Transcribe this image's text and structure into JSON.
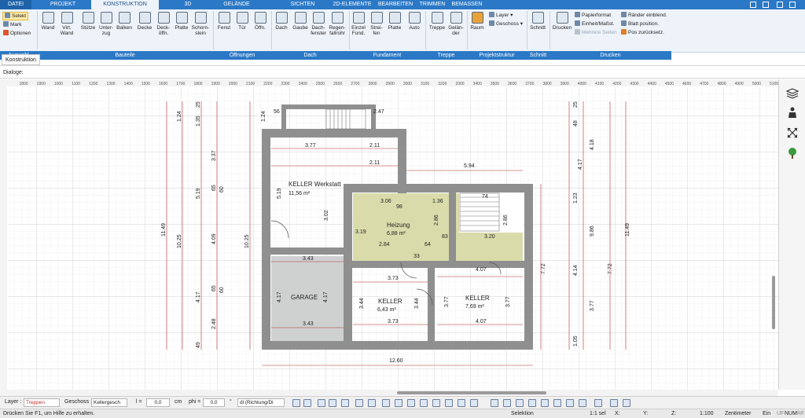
{
  "tabs": {
    "file": "DATEI",
    "projekt": "PROJEKT",
    "konstruktion": "KONSTRUKTION",
    "d3": "3D",
    "gelaende": "GELÄNDE",
    "sichten": "SICHTEN",
    "elemente2d": "2D-ELEMENTE",
    "bearbeiten": "BEARBEITEN",
    "trimmen": "TRIMMEN",
    "bemassen": "BEMASSEN"
  },
  "ribbon": {
    "selekt": "Selekt",
    "mark": "Mark",
    "optionen": "Optionen",
    "wand": "Wand",
    "virt_wand": "Virt. Wand",
    "stuetze": "Stütze",
    "unterzug": "Unter-zug",
    "balken": "Balken",
    "decke": "Decke",
    "deckoeffn": "Deck-öffn.",
    "platte": "Platte",
    "schornstein": "Schorn-stein",
    "fenst": "Fenst",
    "tuer": "Tür",
    "oeffn": "Öffn.",
    "dach": "Dach",
    "gaube": "Gaube",
    "dachfenster": "Dach-fenster",
    "regenfallrohr": "Regen-fallrohr",
    "einzelfund": "Einzel Fund.",
    "streifen": "Strei-fen",
    "platte2": "Platte",
    "auto": "Auto",
    "treppe": "Treppe",
    "gelaender": "Gelän-der",
    "raum": "Raum",
    "layer": "Layer",
    "geschoss": "Geschoss",
    "schnitt": "Schnitt",
    "drucken": "Drucken",
    "papierformat": "Papierformat",
    "einheit": "Einheit/Maßst.",
    "mehrere_seiten": "Mehrere Seiten",
    "raender": "Ränder einblend.",
    "blatt": "Blatt position.",
    "pos_zurueck": "Pos zurücksetz."
  },
  "groups": {
    "auswahl": "Auswahl",
    "bauteile": "Bauteile",
    "oeffnungen": "Öffnungen",
    "dach": "Dach",
    "fundament": "Fundament",
    "treppe": "Treppe",
    "projektstruktur": "Projektstruktur",
    "schnitt": "Schnitt",
    "drucken": "Drucken"
  },
  "subtab": "Konstruktion",
  "dialoge": "Dialoge:",
  "ruler": [
    "1800",
    "1900",
    "1000",
    "1100",
    "1200",
    "1300",
    "1400",
    "1500",
    "1600",
    "1700",
    "1800",
    "1900",
    "2000",
    "2100",
    "2200",
    "2300",
    "2400",
    "2500",
    "2600",
    "2700",
    "2800",
    "2900",
    "3000",
    "3100",
    "3200",
    "3300",
    "3400",
    "3500",
    "3600",
    "3700",
    "3800",
    "3900",
    "4000",
    "4100",
    "4200",
    "4300",
    "4400",
    "4500",
    "4600",
    "4700",
    "4800",
    "4900",
    "5000",
    "5100",
    "5200"
  ],
  "plan": {
    "rooms": {
      "werkstatt_name": "KELLER Werkstatt",
      "werkstatt_area": "11,56 m²",
      "heizung_name": "Heizung",
      "heizung_area": "6,88 m²",
      "garage_name": "GARAGE",
      "keller1_name": "KELLER",
      "keller1_area": "6,43 m²",
      "keller2_name": "KELLER",
      "keller2_area": "7,69 m²"
    },
    "dims": {
      "d377": "3.77",
      "d211a": "2.11",
      "d211b": "2.11",
      "d594": "5.94",
      "d306": "3.06",
      "d136": "1.36",
      "d74": "74",
      "d284": "2.84",
      "d64": "64",
      "d83": "83",
      "d320": "3.20",
      "d343a": "3.43",
      "d343b": "3.43",
      "d373a": "3.73",
      "d373b": "3.73",
      "d407a": "4.07",
      "d407b": "4.07",
      "d1260": "12.60",
      "d56": "56",
      "d247": "2.47",
      "d519": "5.19",
      "d302": "3.02",
      "d319": "3.19",
      "d286a": "2.86",
      "d286b": "2.86",
      "d417a": "4.17",
      "d417b": "4.17",
      "d344a": "3.44",
      "d344b": "3.44",
      "d377b": "3.77",
      "d377c": "3.77",
      "d98": "98",
      "d33": "33",
      "d1149": "11.49",
      "d1025a": "10.25",
      "d1025b": "10.25",
      "d519b": "5.19",
      "d409": "4.09",
      "d337": "3.37",
      "d248": "2.48",
      "d417c": "4.17",
      "d65a": "65",
      "d65b": "65",
      "d124a": "1.24",
      "d124b": "1.24",
      "d135": "1.35",
      "d25": "25",
      "d60a": "60",
      "d60b": "60",
      "d49": "49",
      "d772a": "7.72",
      "d772b": "7.72",
      "d417d": "4.17",
      "d418": "4.18",
      "d1149b": "11.49",
      "d986": "9.86",
      "d414": "4.14",
      "d377d": "3.77",
      "d123": "1.23",
      "d105": "1.05",
      "d48": "48",
      "d25b": "25"
    }
  },
  "statusbar": {
    "layer_label": "Layer :",
    "layer_value": "Treppen",
    "geschoss_label": "Geschoss :",
    "geschoss_value": "Kellergesch",
    "l_label": "l =",
    "l_value": "0,0",
    "cm": "cm",
    "phi_label": "phi =",
    "phi_value": "0,0",
    "deg": "°",
    "mode": "dl (Richtung/Di",
    "help": "Drücken Sie F1, um Hilfe zu erhalten.",
    "selektion": "Selektion",
    "scale1": "1:1 sel",
    "x": "X:",
    "y": "Y:",
    "z": "Z:",
    "scale2": "1:100",
    "unit": "Zentimeter",
    "ein": "Ein",
    "uf": "UF",
    "num": "NUM",
    "rf": "RF"
  },
  "colors": {
    "ribbon_blue": "#2b78c6",
    "heizung_fill": "#d9dcaa",
    "garage_fill": "#cfd1d1",
    "wall": "#8f8f8f",
    "dim_red": "#b0302c"
  }
}
